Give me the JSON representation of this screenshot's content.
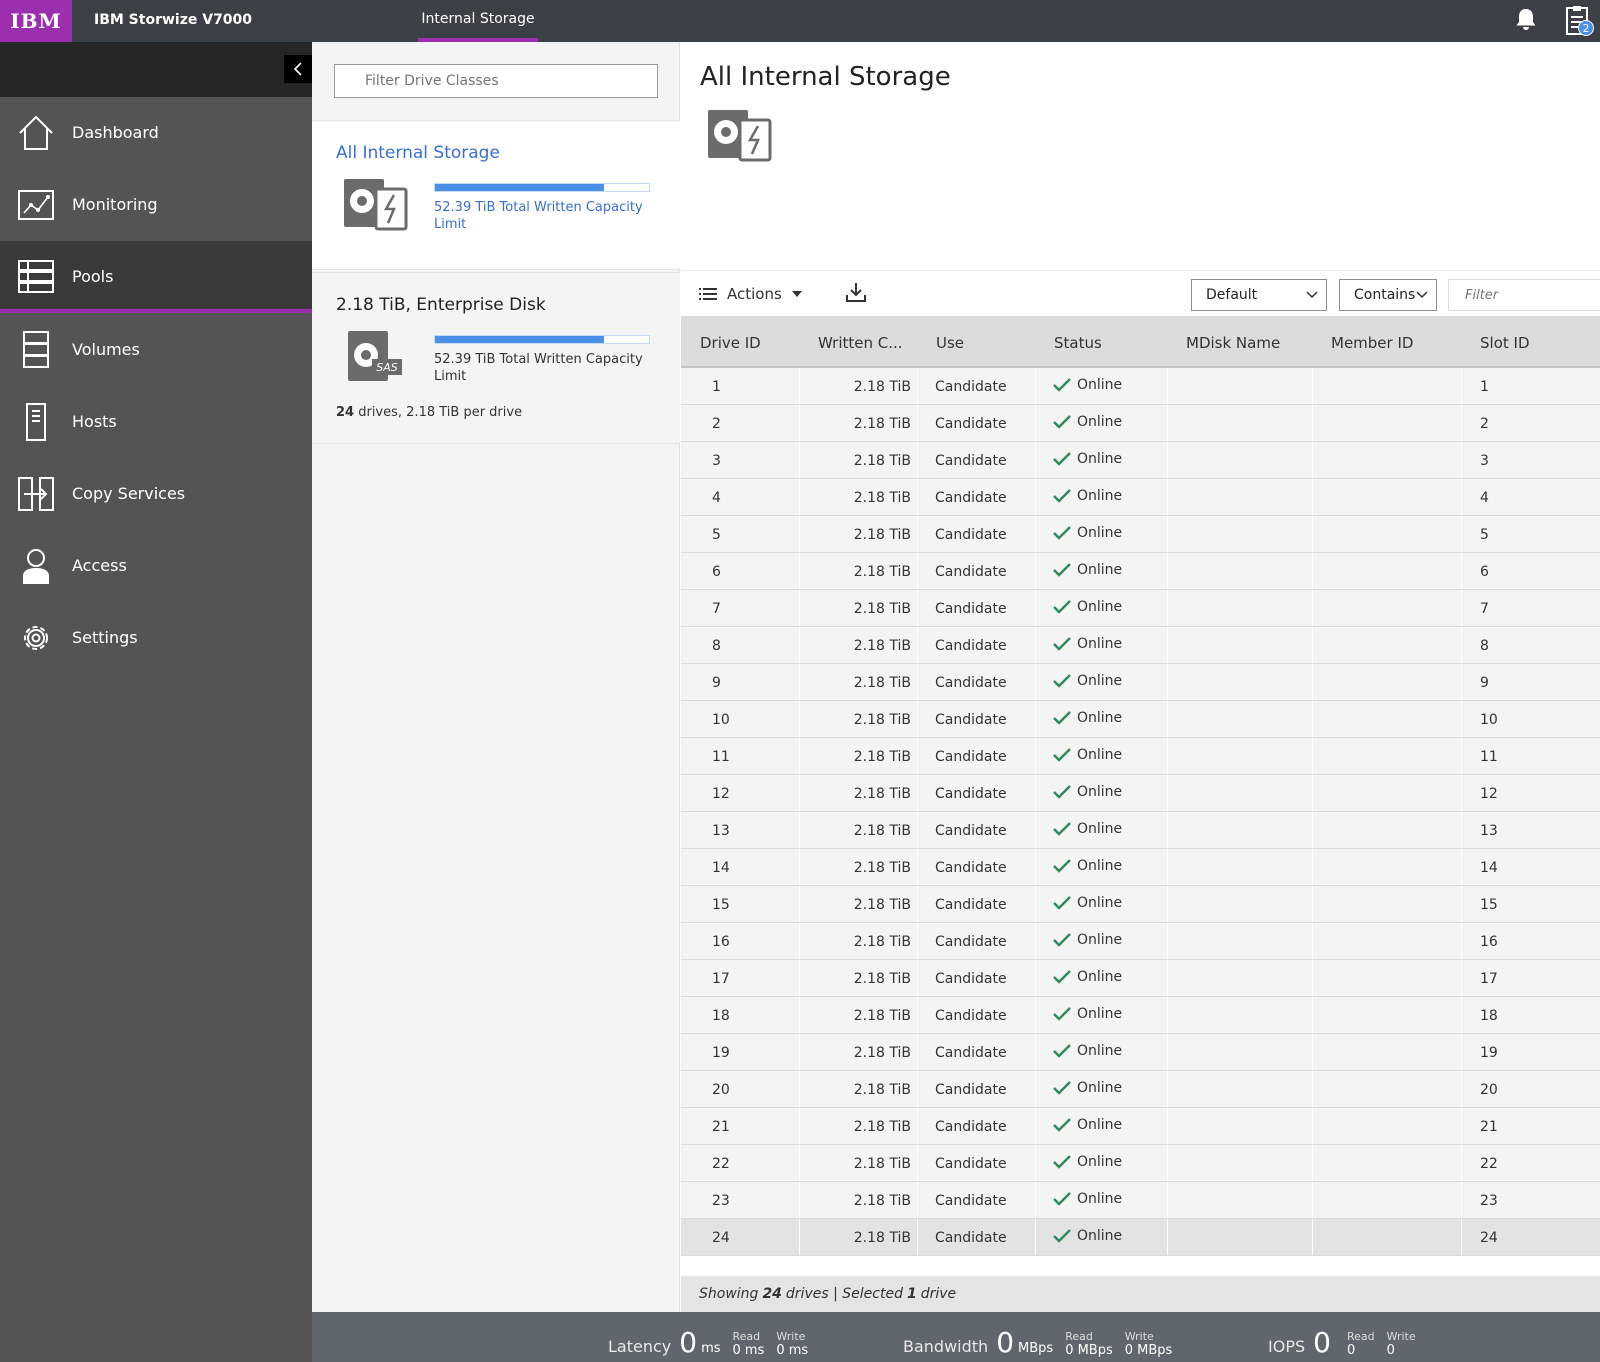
{
  "topbar": {
    "logo": "IBM",
    "product": "IBM Storwize V7000",
    "active_tab": "Internal Storage",
    "tasks_badge": "2"
  },
  "sidebar": {
    "items": [
      {
        "label": "Dashboard",
        "icon": "home-icon"
      },
      {
        "label": "Monitoring",
        "icon": "monitoring-icon"
      },
      {
        "label": "Pools",
        "icon": "pools-icon",
        "active": true
      },
      {
        "label": "Volumes",
        "icon": "volumes-icon"
      },
      {
        "label": "Hosts",
        "icon": "hosts-icon"
      },
      {
        "label": "Copy Services",
        "icon": "copy-services-icon"
      },
      {
        "label": "Access",
        "icon": "user-icon"
      },
      {
        "label": "Settings",
        "icon": "gear-icon"
      }
    ]
  },
  "drive_classes": {
    "filter_placeholder": "Filter Drive Classes",
    "cards": [
      {
        "title": "All Internal Storage",
        "capacity_fraction": 0.79,
        "capacity_text": "52.39 TiB Total Written Capacity Limit"
      },
      {
        "title": "2.18 TiB, Enterprise Disk",
        "badge": "SAS",
        "capacity_fraction": 0.79,
        "capacity_text": "52.39 TiB Total Written Capacity Limit",
        "drive_count": "24",
        "drive_summary_rest": " drives, 2.18 TiB per drive"
      }
    ]
  },
  "main": {
    "title": "All Internal Storage",
    "toolbar": {
      "actions_label": "Actions",
      "view_select": "Default",
      "match_select": "Contains",
      "filter_placeholder": "Filter"
    },
    "columns": [
      "Drive ID",
      "Written C...",
      "Use",
      "Status",
      "MDisk Name",
      "Member ID",
      "Slot ID"
    ],
    "rows": [
      {
        "id": "1",
        "cap": "2.18 TiB",
        "use": "Candidate",
        "status": "Online",
        "slot": "1"
      },
      {
        "id": "2",
        "cap": "2.18 TiB",
        "use": "Candidate",
        "status": "Online",
        "slot": "2"
      },
      {
        "id": "3",
        "cap": "2.18 TiB",
        "use": "Candidate",
        "status": "Online",
        "slot": "3"
      },
      {
        "id": "4",
        "cap": "2.18 TiB",
        "use": "Candidate",
        "status": "Online",
        "slot": "4"
      },
      {
        "id": "5",
        "cap": "2.18 TiB",
        "use": "Candidate",
        "status": "Online",
        "slot": "5"
      },
      {
        "id": "6",
        "cap": "2.18 TiB",
        "use": "Candidate",
        "status": "Online",
        "slot": "6"
      },
      {
        "id": "7",
        "cap": "2.18 TiB",
        "use": "Candidate",
        "status": "Online",
        "slot": "7"
      },
      {
        "id": "8",
        "cap": "2.18 TiB",
        "use": "Candidate",
        "status": "Online",
        "slot": "8"
      },
      {
        "id": "9",
        "cap": "2.18 TiB",
        "use": "Candidate",
        "status": "Online",
        "slot": "9"
      },
      {
        "id": "10",
        "cap": "2.18 TiB",
        "use": "Candidate",
        "status": "Online",
        "slot": "10"
      },
      {
        "id": "11",
        "cap": "2.18 TiB",
        "use": "Candidate",
        "status": "Online",
        "slot": "11"
      },
      {
        "id": "12",
        "cap": "2.18 TiB",
        "use": "Candidate",
        "status": "Online",
        "slot": "12"
      },
      {
        "id": "13",
        "cap": "2.18 TiB",
        "use": "Candidate",
        "status": "Online",
        "slot": "13"
      },
      {
        "id": "14",
        "cap": "2.18 TiB",
        "use": "Candidate",
        "status": "Online",
        "slot": "14"
      },
      {
        "id": "15",
        "cap": "2.18 TiB",
        "use": "Candidate",
        "status": "Online",
        "slot": "15"
      },
      {
        "id": "16",
        "cap": "2.18 TiB",
        "use": "Candidate",
        "status": "Online",
        "slot": "16"
      },
      {
        "id": "17",
        "cap": "2.18 TiB",
        "use": "Candidate",
        "status": "Online",
        "slot": "17"
      },
      {
        "id": "18",
        "cap": "2.18 TiB",
        "use": "Candidate",
        "status": "Online",
        "slot": "18"
      },
      {
        "id": "19",
        "cap": "2.18 TiB",
        "use": "Candidate",
        "status": "Online",
        "slot": "19"
      },
      {
        "id": "20",
        "cap": "2.18 TiB",
        "use": "Candidate",
        "status": "Online",
        "slot": "20"
      },
      {
        "id": "21",
        "cap": "2.18 TiB",
        "use": "Candidate",
        "status": "Online",
        "slot": "21"
      },
      {
        "id": "22",
        "cap": "2.18 TiB",
        "use": "Candidate",
        "status": "Online",
        "slot": "22"
      },
      {
        "id": "23",
        "cap": "2.18 TiB",
        "use": "Candidate",
        "status": "Online",
        "slot": "23"
      },
      {
        "id": "24",
        "cap": "2.18 TiB",
        "use": "Candidate",
        "status": "Online",
        "slot": "24",
        "selected": true
      }
    ],
    "footer": {
      "prefix": "Showing",
      "count": "24",
      "middle": "drives | Selected",
      "selected": "1",
      "suffix": "drive"
    }
  },
  "statusbar": {
    "latency": {
      "label": "Latency",
      "value": "0",
      "unit": "ms",
      "read_label": "Read",
      "read": "0 ms",
      "write_label": "Write",
      "write": "0 ms"
    },
    "bandwidth": {
      "label": "Bandwidth",
      "value": "0",
      "unit": "MBps",
      "read_label": "Read",
      "read": "0 MBps",
      "write_label": "Write",
      "write": "0 MBps"
    },
    "iops": {
      "label": "IOPS",
      "value": "0",
      "unit": "",
      "read_label": "Read",
      "read": "0",
      "write_label": "Write",
      "write": "0"
    }
  },
  "colors": {
    "brand_purple": "#9b2fae",
    "link_blue": "#3a6fcd",
    "bar_blue": "#4a8fe8",
    "online_green": "#2e8b57"
  }
}
